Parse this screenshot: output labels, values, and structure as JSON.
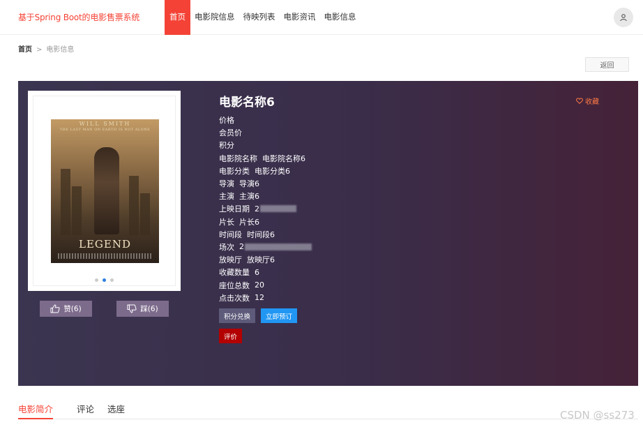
{
  "header": {
    "brand": "基于Spring Boot的电影售票系统",
    "nav": [
      {
        "label": "首页",
        "active": true
      },
      {
        "label": "电影院信息",
        "active": false
      },
      {
        "label": "待映列表",
        "active": false
      },
      {
        "label": "电影资讯",
        "active": false
      },
      {
        "label": "电影信息",
        "active": false
      }
    ],
    "avatar_icon": "user-icon"
  },
  "breadcrumb": {
    "home": "首页",
    "separator": ">",
    "current": "电影信息"
  },
  "back_label": "返回",
  "poster": {
    "tagline": "WILL SMITH",
    "tagline2": "THE LAST MAN ON EARTH IS NOT ALONE",
    "title_text": "LEGEND",
    "carousel_dots": 3,
    "active_dot": 1
  },
  "likes": {
    "like_label": "赞(6)",
    "dislike_label": "踩(6)"
  },
  "movie": {
    "title": "电影名称6",
    "favorite_label": "收藏",
    "fields": [
      {
        "key": "价格",
        "value": ""
      },
      {
        "key": "会员价",
        "value": ""
      },
      {
        "key": "积分",
        "value": ""
      },
      {
        "key": "电影院名称",
        "value": "电影院名称6"
      },
      {
        "key": "电影分类",
        "value": "电影分类6"
      },
      {
        "key": "导演",
        "value": "导演6"
      },
      {
        "key": "主演",
        "value": "主演6"
      },
      {
        "key": "上映日期",
        "value": "2"
      },
      {
        "key": "片长",
        "value": "片长6"
      },
      {
        "key": "时间段",
        "value": "时间段6"
      },
      {
        "key": "场次",
        "value": "2"
      },
      {
        "key": "放映厅",
        "value": "放映厅6"
      },
      {
        "key": "收藏数量",
        "value": "6"
      },
      {
        "key": "座位总数",
        "value": "20"
      },
      {
        "key": "点击次数",
        "value": "12"
      }
    ]
  },
  "actions": {
    "exchange": "积分兑换",
    "book": "立即预订",
    "review": "评价"
  },
  "tabs": [
    {
      "label": "电影简介",
      "active": true
    },
    {
      "label": "评论",
      "active": false
    },
    {
      "label": "选座",
      "active": false
    }
  ],
  "watermark": "CSDN @ss273",
  "colors": {
    "accent": "#f44336",
    "book": "#2196f3",
    "review": "#b30000",
    "favorite": "#ff7a45"
  }
}
